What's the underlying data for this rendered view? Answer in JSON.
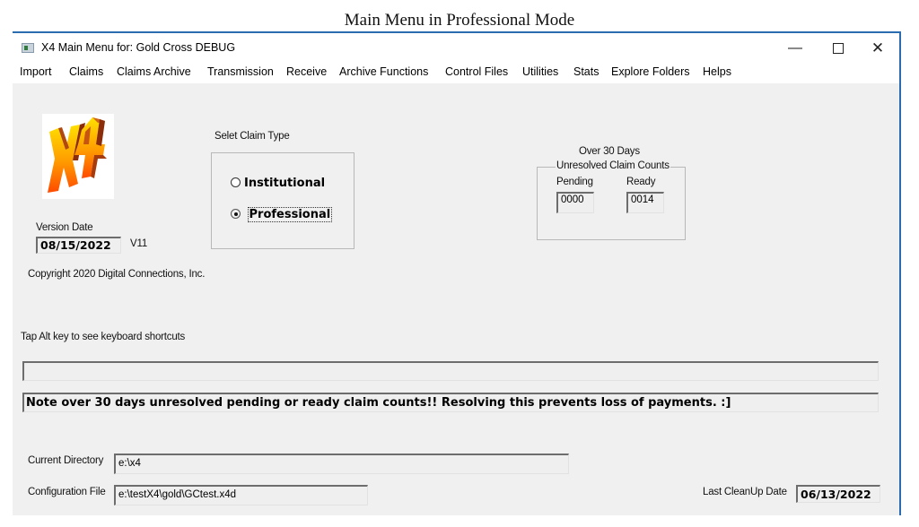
{
  "caption": "Main Menu in Professional Mode",
  "window": {
    "title": "X4 Main Menu for: Gold Cross DEBUG",
    "controls": {
      "minimize": "—",
      "maximize": "",
      "close": "✕"
    }
  },
  "menu": [
    "Import",
    "Claims",
    "Claims Archive",
    "Transmission",
    "Receive",
    "Archive Functions",
    "Control Files",
    "Utilities",
    "Stats",
    "Explore Folders",
    "Helps"
  ],
  "logo": {
    "text": "X4",
    "icon": "x4-logo"
  },
  "version": {
    "label": "Version Date",
    "date": "08/15/2022",
    "version": "V11"
  },
  "copyright": "Copyright 2020 Digital Connections, Inc.",
  "claim_type": {
    "label": "Selet Claim Type",
    "options": [
      {
        "label": "Institutional",
        "selected": false
      },
      {
        "label": "Professional",
        "selected": true
      }
    ]
  },
  "unresolved": {
    "heading": "Over 30 Days",
    "group_label": "Unresolved Claim Counts",
    "pending_label": "Pending",
    "pending_value": "0000",
    "ready_label": "Ready",
    "ready_value": "0014"
  },
  "hint": "Tap Alt key to see keyboard shortcuts",
  "status_line": "",
  "note": "Note over 30 days unresolved pending or ready claim counts!!  Resolving this prevents loss of payments. :]",
  "current_directory": {
    "label": "Current Directory",
    "value": "e:\\x4"
  },
  "configuration_file": {
    "label": "Configuration File",
    "value": "e:\\testX4\\gold\\GCtest.x4d"
  },
  "last_cleanup": {
    "label": "Last CleanUp Date",
    "value": "06/13/2022"
  }
}
